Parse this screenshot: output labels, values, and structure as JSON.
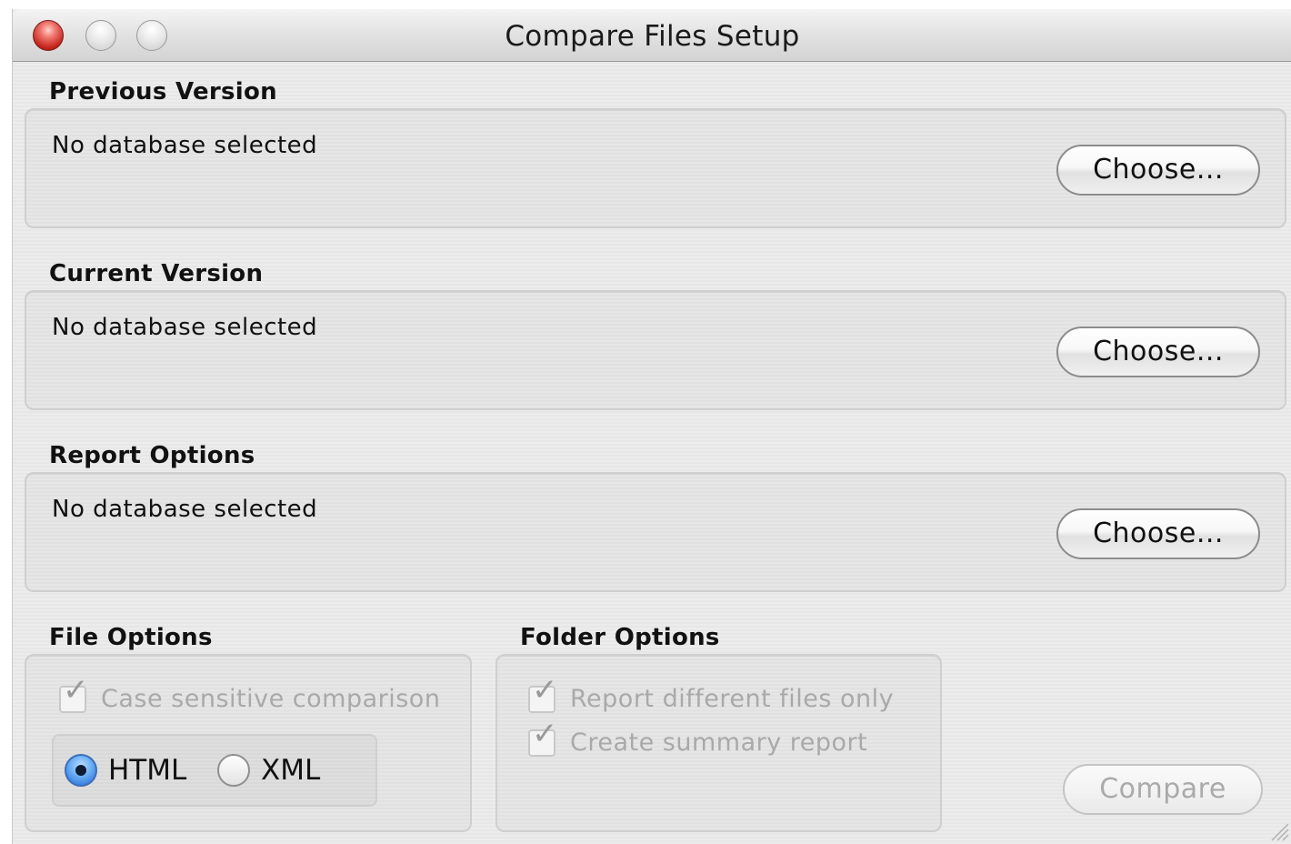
{
  "window": {
    "title": "Compare Files Setup"
  },
  "previous_version": {
    "label": "Previous Version",
    "status": "No database selected",
    "choose_label": "Choose..."
  },
  "current_version": {
    "label": "Current Version",
    "status": "No database selected",
    "choose_label": "Choose..."
  },
  "report_options": {
    "label": "Report Options",
    "status": "No database selected",
    "choose_label": "Choose..."
  },
  "file_options": {
    "label": "File Options",
    "case_sensitive": {
      "label": "Case sensitive comparison",
      "checked": true,
      "enabled": false
    },
    "format": {
      "selected": "HTML",
      "options": [
        "HTML",
        "XML"
      ]
    }
  },
  "folder_options": {
    "label": "Folder Options",
    "report_different": {
      "label": "Report different files only",
      "checked": true,
      "enabled": false
    },
    "create_summary": {
      "label": "Create summary report",
      "checked": true,
      "enabled": false
    }
  },
  "actions": {
    "compare_label": "Compare",
    "compare_enabled": false
  },
  "colors": {
    "close_button": "#c2231b",
    "radio_selected": "#1f66d0",
    "disabled_text": "#a9a9a9"
  }
}
